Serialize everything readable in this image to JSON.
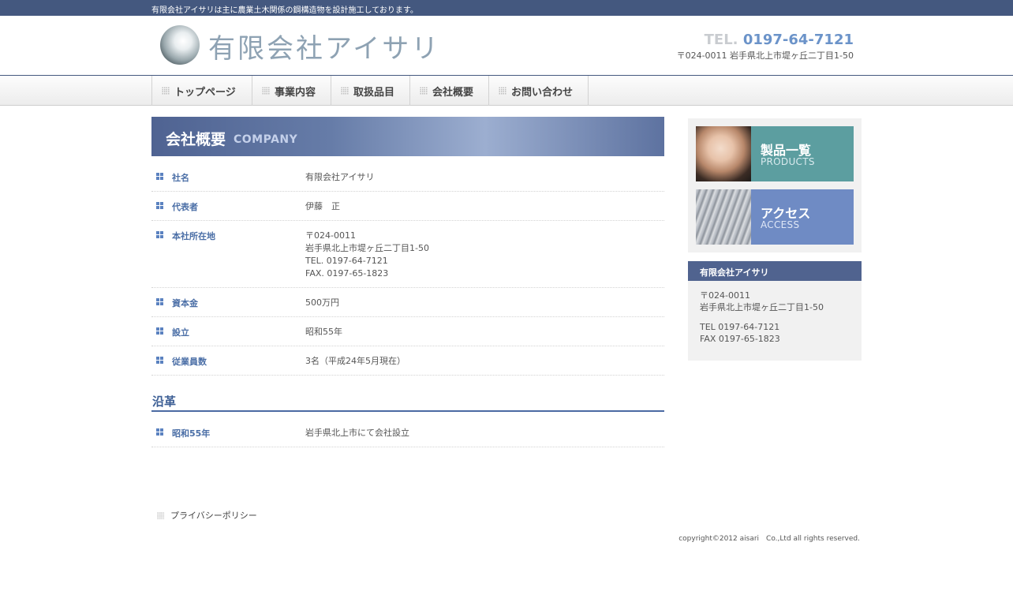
{
  "topbar": {
    "text": "有限会社アイサリは主に農業土木関係の鋼構造物を設計施工しております。"
  },
  "header": {
    "logo_text": "有限会社アイサリ",
    "tel_label": "TEL.",
    "tel_number": "0197-64-7121",
    "address": "〒024-0011 岩手県北上市堤ヶ丘二丁目1-50"
  },
  "nav": {
    "items": [
      {
        "label": "トップページ"
      },
      {
        "label": "事業内容"
      },
      {
        "label": "取扱品目"
      },
      {
        "label": "会社概要"
      },
      {
        "label": "お問い合わせ"
      }
    ]
  },
  "main": {
    "title_jp": "会社概要",
    "title_en": "COMPANY",
    "rows": [
      {
        "label": "社名",
        "lines": [
          "有限会社アイサリ"
        ]
      },
      {
        "label": "代表者",
        "lines": [
          "伊藤　正"
        ]
      },
      {
        "label": "本社所在地",
        "lines": [
          "〒024-0011",
          "岩手県北上市堤ヶ丘二丁目1-50",
          "TEL. 0197-64-7121",
          "FAX. 0197-65-1823"
        ]
      },
      {
        "label": "資本金",
        "lines": [
          "500万円"
        ]
      },
      {
        "label": "設立",
        "lines": [
          "昭和55年"
        ]
      },
      {
        "label": "従業員数",
        "lines": [
          "3名（平成24年5月現在）"
        ]
      }
    ],
    "history_title": "沿革",
    "history": [
      {
        "label": "昭和55年",
        "lines": [
          "岩手県北上市にて会社設立"
        ]
      }
    ]
  },
  "sidebar": {
    "banners": [
      {
        "jp": "製品一覧",
        "en": "PRODUCTS"
      },
      {
        "jp": "アクセス",
        "en": "ACCESS"
      }
    ],
    "company": {
      "title": "有限会社アイサリ",
      "postal": "〒024-0011",
      "address": "岩手県北上市堤ヶ丘二丁目1-50",
      "tel": "TEL 0197-64-7121",
      "fax": "FAX 0197-65-1823"
    }
  },
  "footer": {
    "privacy_label": "プライバシーポリシー",
    "copyright": "copyright©2012 aisari　Co.,Ltd all rights reserved."
  }
}
